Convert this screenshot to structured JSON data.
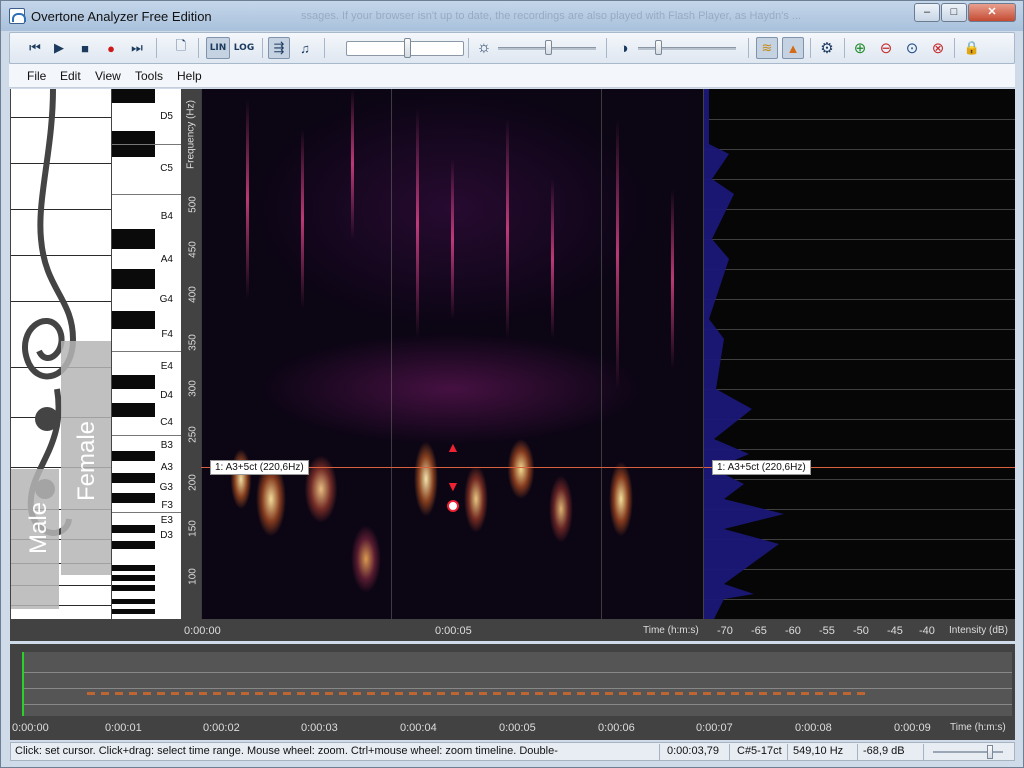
{
  "window": {
    "title": "Overtone Analyzer Free Edition",
    "ghost_text": "ssages. If your browser isn't up to date, the recordings are also played with Flash Player, as Haydn's ..."
  },
  "window_buttons": {
    "minimize": "–",
    "maximize": "□",
    "close": "✕"
  },
  "toolbar": {
    "lin_label": "LIN",
    "log_label": "LOG",
    "icons": [
      "skip-back",
      "play",
      "stop",
      "record",
      "skip-forward",
      "new-file",
      "lin-scale",
      "log-scale",
      "pitch-track",
      "piano",
      "brightness",
      "contrast",
      "spectrum-view-a",
      "spectrum-view-b",
      "settings",
      "zoom-in",
      "zoom-out",
      "zoom-fit",
      "zoom-reset",
      "lock"
    ],
    "glyphs": {
      "skip_back": "⏮",
      "play": "▶",
      "stop": "■",
      "record": "●",
      "skip_forward": "⏭",
      "new_file": "🗋",
      "settings": "⚙",
      "brightness": "☼",
      "contrast": "◑",
      "zoom_in": "⊕",
      "zoom_out": "⊖",
      "zoom_fit": "⊙",
      "zoom_reset": "⊗",
      "lock": "🔒",
      "pitch_track": "⇶",
      "piano": "♫",
      "view_a": "≋",
      "view_b": "▲"
    }
  },
  "menu": [
    "File",
    "Edit",
    "View",
    "Tools",
    "Help"
  ],
  "staff": {
    "female_label": "Female",
    "male_label": "Male"
  },
  "piano_notes": [
    {
      "name": "D5"
    },
    {
      "name": "C5"
    },
    {
      "name": "B4"
    },
    {
      "name": "A4"
    },
    {
      "name": "G4"
    },
    {
      "name": "F4"
    },
    {
      "name": "E4"
    },
    {
      "name": "D4"
    },
    {
      "name": "C4"
    },
    {
      "name": "B3"
    },
    {
      "name": "A3"
    },
    {
      "name": "G3"
    },
    {
      "name": "F3"
    },
    {
      "name": "E3"
    },
    {
      "name": "D3"
    }
  ],
  "frequency_axis": {
    "title": "Frequency (Hz)",
    "ticks": [
      "500",
      "450",
      "400",
      "350",
      "300",
      "250",
      "200",
      "150",
      "100"
    ]
  },
  "time_axis": {
    "ticks": [
      "0:00:00",
      "0:00:05"
    ],
    "title": "Time (h:m:s)"
  },
  "intensity_axis": {
    "ticks": [
      "-70",
      "-65",
      "-60",
      "-55",
      "-50",
      "-45",
      "-40"
    ],
    "title": "Intensity (dB)"
  },
  "cursor": {
    "label": "1: A3+5ct (220,6Hz)"
  },
  "timeline": {
    "ticks": [
      "0:00:00",
      "0:00:01",
      "0:00:02",
      "0:00:03",
      "0:00:04",
      "0:00:05",
      "0:00:06",
      "0:00:07",
      "0:00:08",
      "0:00:09"
    ],
    "title": "Time (h:m:s)"
  },
  "status": {
    "hint": "Click: set cursor. Click+drag: select time range. Mouse wheel: zoom. Ctrl+mouse wheel: zoom timeline. Double-",
    "time": "0:00:03,79",
    "note": "C#5-17ct",
    "frequency": "549,10 Hz",
    "level": "-68,9 dB"
  }
}
